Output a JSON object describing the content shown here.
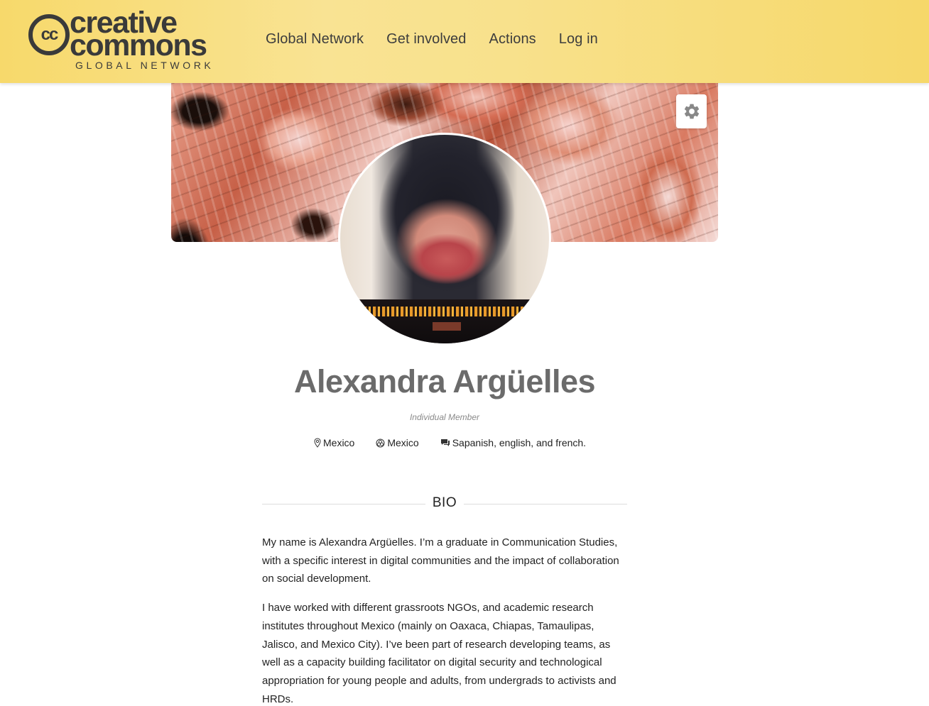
{
  "header": {
    "logo": {
      "mark": "cc",
      "word1": "creative",
      "word2": "commons",
      "subtitle": "GLOBAL NETWORK"
    },
    "nav": [
      {
        "label": "Global Network"
      },
      {
        "label": "Get involved"
      },
      {
        "label": "Actions"
      },
      {
        "label": "Log in"
      }
    ]
  },
  "profile": {
    "settings_icon": "gear-icon",
    "name": "Alexandra Argüelles",
    "role": "Individual Member",
    "meta": {
      "location": {
        "icon": "map-pin-icon",
        "text": "Mexico"
      },
      "chapter": {
        "icon": "cc-chapter-icon",
        "text": "Mexico"
      },
      "languages": {
        "icon": "speech-bubble-icon",
        "text": "Sapanish, english, and french."
      }
    }
  },
  "bio": {
    "title": "BIO",
    "paragraphs": [
      "My name is Alexandra Argüelles. I’m a graduate in Communication Studies, with a specific interest in digital communities and the impact of collaboration on social development.",
      "I have worked with different grassroots NGOs, and academic research institutes throughout Mexico (mainly on Oaxaca, Chiapas, Tamaulipas, Jalisco, and Mexico City). I’ve been part of research developing teams, as well as a capacity building facilitator on digital security and technological appropriation for young people and adults, from undergrads to activists and HRDs."
    ]
  },
  "colors": {
    "header_bg": "#f7d96b",
    "nav_text": "#3d3d3d",
    "name_text": "#6b6b6b"
  }
}
